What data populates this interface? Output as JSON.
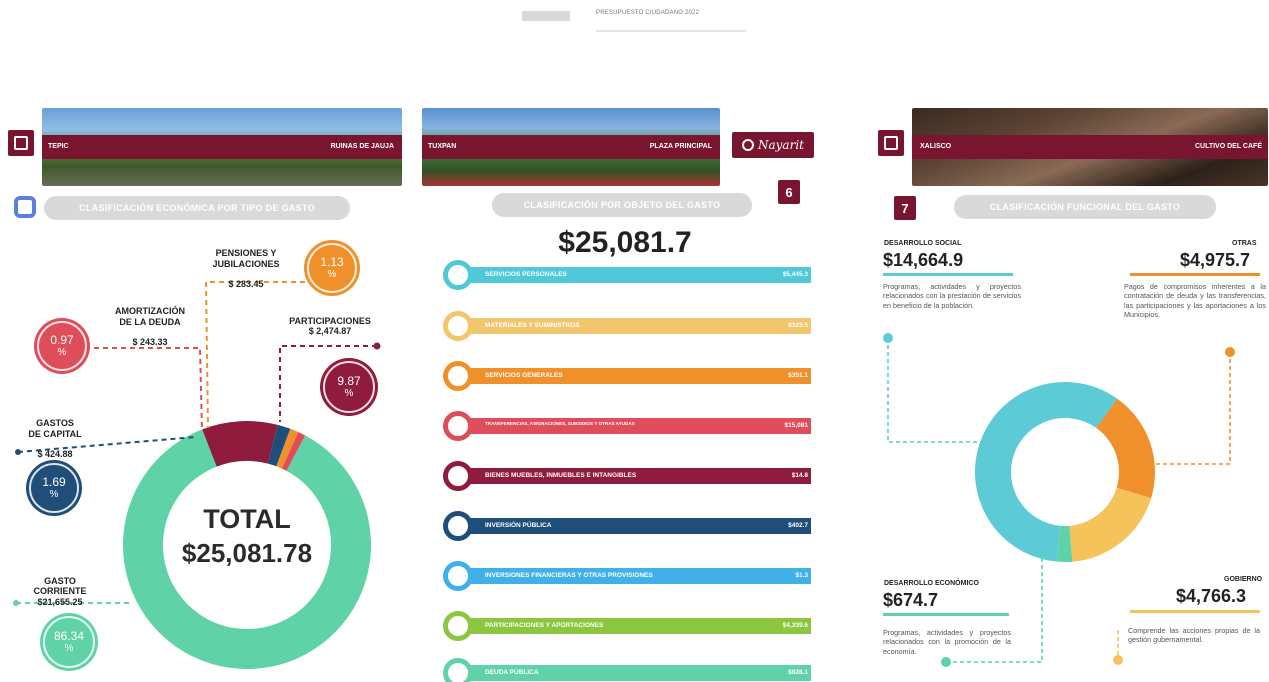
{
  "header": {
    "title": "PRESUPUESTO CIUDADANO 2022"
  },
  "panels": {
    "left": {
      "banner_left": "TEPIC",
      "banner_right": "RUINAS DE JAUJA",
      "pill": "CLASIFICACIÓN ECONÓMICA POR TIPO DE GASTO"
    },
    "middle": {
      "banner_left": "TUXPAN",
      "banner_right": "PLAZA PRINCIPAL",
      "brand": "Nayarit",
      "page": "6",
      "pill": "CLASIFICACIÓN POR OBJETO DEL GASTO",
      "amount": "$25,081.7"
    },
    "right": {
      "banner_left": "XALISCO",
      "banner_right": "CULTIVO DEL CAFÉ",
      "page": "7",
      "pill": "CLASIFICACIÓN FUNCIONAL DEL GASTO"
    }
  },
  "economic": {
    "total_label": "TOTAL",
    "total_value": "$25,081.78",
    "items": [
      {
        "name": "GASTO CORRIENTE",
        "amount": "$21,655.25",
        "pct": "86.34",
        "unit": "%"
      },
      {
        "name": "PARTICIPACIONES",
        "amount": "$ 2,474.87",
        "pct": "9.87",
        "unit": "%"
      },
      {
        "name": "GASTOS\nDE CAPITAL",
        "amount": "$ 424.88",
        "pct": "1.69",
        "unit": "%"
      },
      {
        "name": "PENSIONES Y\nJUBILACIONES",
        "amount": "$ 283.45",
        "pct": "1.13",
        "unit": "%"
      },
      {
        "name": "AMORTIZACIÓN\nDE LA DEUDA",
        "amount": "$ 243.33",
        "pct": "0.97",
        "unit": "%"
      }
    ]
  },
  "objeto": {
    "bars": [
      {
        "label": "SERVICIOS PERSONALES",
        "value": "$5,445.3"
      },
      {
        "label": "MATERIALES Y SUMINISTROS",
        "value": "$323.5"
      },
      {
        "label": "SERVICIOS GENERALES",
        "value": "$351.1"
      },
      {
        "label": "TRANSFERENCIAS, ASIGNACIONES, SUBSIDIOS Y OTRAS AYUDAS",
        "value": "$15,081"
      },
      {
        "label": "BIENES MUEBLES, INMUEBLES E INTANGIBLES",
        "value": "$14.8"
      },
      {
        "label": "INVERSIÓN PÚBLICA",
        "value": "$402.7"
      },
      {
        "label": "INVERSIONES FINANCIERAS Y OTRAS PROVISIONES",
        "value": "$1.3"
      },
      {
        "label": "PARTICIPACIONES Y APORTACIONES",
        "value": "$4,339.6"
      },
      {
        "label": "DEUDA PÚBLICA",
        "value": "$828.1"
      }
    ]
  },
  "funcional": {
    "items": [
      {
        "name": "DESARROLLO SOCIAL",
        "amount": "$14,664.9",
        "desc": "Programas, actividades y proyectos relacionados con la prestación de servicios en beneficio de la población."
      },
      {
        "name": "OTRAS",
        "amount": "$4,975.7",
        "desc": "Pagos de compromisos inherentes a la contratación de deuda y las transferencias, las participaciones y las aportaciones a los Municipios."
      },
      {
        "name": "DESARROLLO ECONÓMICO",
        "amount": "$674.7",
        "desc": "Programas, actividades y proyectos relacionados con la promoción de la economía."
      },
      {
        "name": "GOBIERNO",
        "amount": "$4,766.3",
        "desc": "Comprende las acciones propias de la gestión gubernamental."
      }
    ]
  },
  "chart_data": [
    {
      "type": "pie",
      "categories": [
        "GASTO CORRIENTE",
        "PARTICIPACIONES",
        "GASTOS DE CAPITAL",
        "PENSIONES Y JUBILACIONES",
        "AMORTIZACIÓN DE LA DEUDA"
      ],
      "values": [
        86.34,
        9.87,
        1.69,
        1.13,
        0.97
      ],
      "colors": [
        "#5fd3a7",
        "#8f1c3c",
        "#1f4e79",
        "#f0902a",
        "#e04d5a"
      ]
    },
    {
      "type": "bar",
      "categories": [
        "SERVICIOS PERSONALES",
        "MATERIALES Y SUMINISTROS",
        "SERVICIOS GENERALES",
        "TRANSFERENCIAS, ASIGNACIONES, SUBSIDIOS Y OTRAS AYUDAS",
        "BIENES MUEBLES, INMUEBLES E INTANGIBLES",
        "INVERSIÓN PÚBLICA",
        "INVERSIONES FINANCIERAS Y OTRAS PROVISIONES",
        "PARTICIPACIONES Y APORTACIONES",
        "DEUDA PÚBLICA"
      ],
      "values": [
        5445.3,
        323.5,
        351.1,
        15081,
        14.8,
        402.7,
        1.3,
        4339.6,
        828.1
      ],
      "colors": [
        "#4fc8d8",
        "#f2c66d",
        "#f0902a",
        "#e04d5a",
        "#8f1c3c",
        "#1f4e79",
        "#3fb0e8",
        "#8cc63f",
        "#5fd3a7"
      ]
    },
    {
      "type": "pie",
      "categories": [
        "DESARROLLO SOCIAL",
        "OTRAS",
        "GOBIERNO",
        "DESARROLLO ECONÓMICO"
      ],
      "values": [
        14664.9,
        4975.7,
        4766.3,
        674.7
      ],
      "colors": [
        "#5ccbd6",
        "#f0902a",
        "#f6c25a",
        "#5fd3a7"
      ]
    }
  ]
}
